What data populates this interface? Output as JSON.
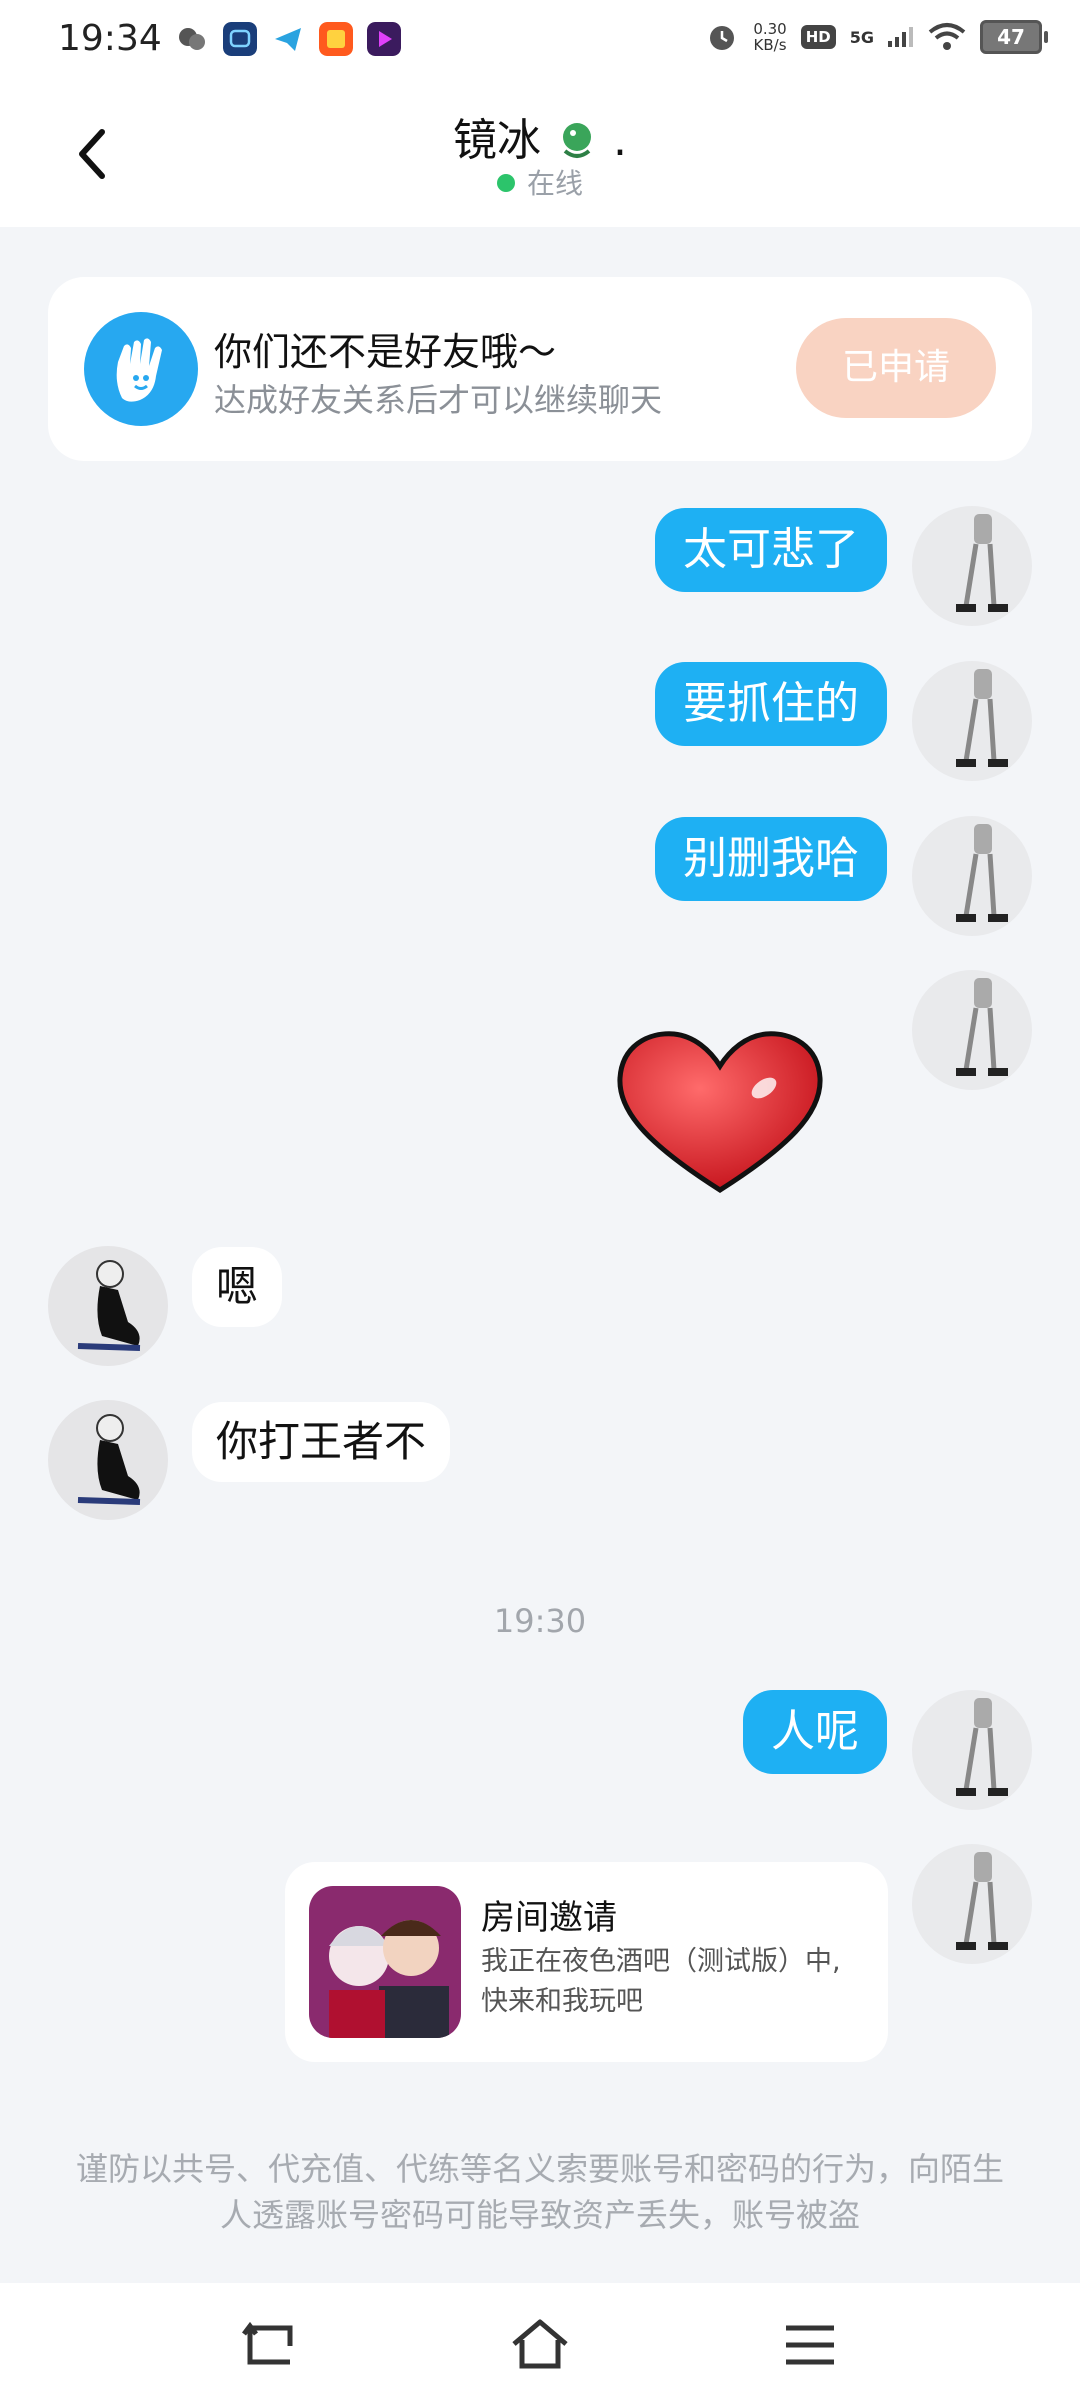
{
  "status": {
    "time": "19:34",
    "net_speed_value": "0.30",
    "net_speed_unit": "KB/s",
    "hd": "HD",
    "signal": "5G",
    "battery": "47",
    "apps": [
      "wechat-icon",
      "chat-bot-icon",
      "telegram-icon",
      "taobao-icon",
      "video-player-icon"
    ]
  },
  "header": {
    "title": "镜冰",
    "title_suffix": ".",
    "status": "在线"
  },
  "friend_card": {
    "title": "你们还不是好友哦～",
    "subtitle": "达成好友关系后才可以继续聊天",
    "button": "已申请"
  },
  "messages": {
    "m1": "太可悲了",
    "m2": "要抓住的",
    "m3": "别删我哈",
    "m5": "嗯",
    "m6": "你打王者不",
    "timestamp": "19:30",
    "m7": "人呢"
  },
  "invite": {
    "title": "房间邀请",
    "desc": "我正在夜色酒吧（测试版）中, 快来和我玩吧"
  },
  "notice": "谨防以共号、代充值、代练等名义索要账号和密码的行为，向陌生人透露账号密码可能导致资产丢失，账号被盗",
  "colors": {
    "accent_blue": "#1eb0f3",
    "online_green": "#2cc46b",
    "applied_button": "#f9d3c2",
    "background": "#f3f5f8"
  }
}
